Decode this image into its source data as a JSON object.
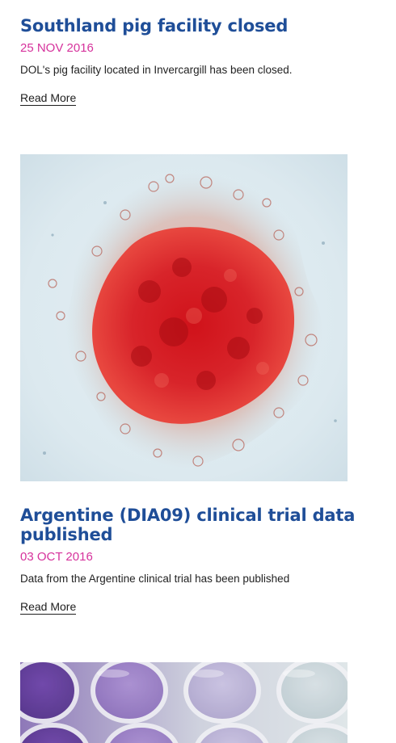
{
  "articles": [
    {
      "title": "Southland pig facility closed",
      "date": "25 NOV 2016",
      "excerpt": "DOL's pig facility located in Invercargill has been closed.",
      "read_more": "Read More"
    },
    {
      "title": "Argentine (DIA09) clinical trial data published",
      "date": "03 OCT 2016",
      "excerpt": "Data from the Argentine clinical trial has been published",
      "read_more": "Read More"
    }
  ],
  "colors": {
    "title": "#1f4e98",
    "date": "#d6329c",
    "text": "#222222"
  },
  "images": [
    {
      "subject": "red-stained-islet-micrograph"
    },
    {
      "subject": "purple-well-plate-photo"
    }
  ]
}
